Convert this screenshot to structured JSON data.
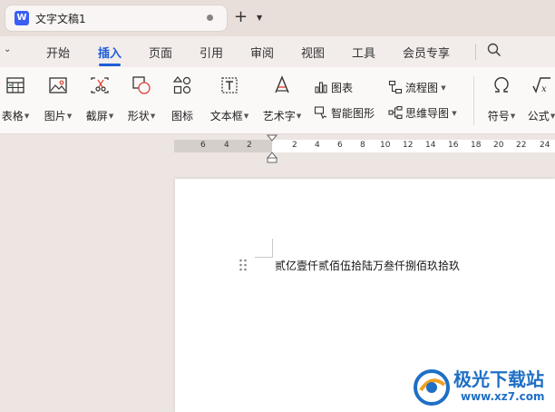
{
  "titlebar": {
    "doc_icon_letter": "W",
    "doc_name": "文字文稿1",
    "new_tab_symbol": "+"
  },
  "menu": {
    "items": [
      "开始",
      "插入",
      "页面",
      "引用",
      "审阅",
      "视图",
      "工具",
      "会员专享"
    ],
    "active": "插入"
  },
  "ribbon": {
    "tools": [
      {
        "label": "表格",
        "icon": "table-icon"
      },
      {
        "label": "图片",
        "icon": "image-icon"
      },
      {
        "label": "截屏",
        "icon": "screenshot-icon"
      },
      {
        "label": "形状",
        "icon": "shape-icon"
      },
      {
        "label": "图标",
        "icon": "icon-library-icon"
      },
      {
        "label": "文本框",
        "icon": "textbox-icon"
      },
      {
        "label": "艺术字",
        "icon": "wordart-icon"
      },
      {
        "label": "符号",
        "icon": "omega-icon"
      },
      {
        "label": "公式",
        "icon": "formula-icon"
      }
    ],
    "chart_label": "图表",
    "smartart_label": "智能图形",
    "flowchart_label": "流程图",
    "mindmap_label": "思维导图"
  },
  "ruler": {
    "left_numbers": [
      "6",
      "4",
      "2"
    ],
    "right_numbers": [
      "2",
      "4",
      "6",
      "8",
      "10",
      "12",
      "14",
      "16",
      "18",
      "20",
      "22",
      "24"
    ]
  },
  "document": {
    "text": "贰亿壹仟贰佰伍拾陆万叁仟捌佰玖拾玖"
  },
  "watermark": {
    "title": "极光下载站",
    "url": "www.xz7.com"
  },
  "colors": {
    "accent": "#1f5cd8",
    "titlebar_bg": "#e8dfdb",
    "ribbon_bg": "#fbf9f8",
    "workspace_bg": "#ece5e1",
    "watermark_blue": "#1f6fc4"
  }
}
